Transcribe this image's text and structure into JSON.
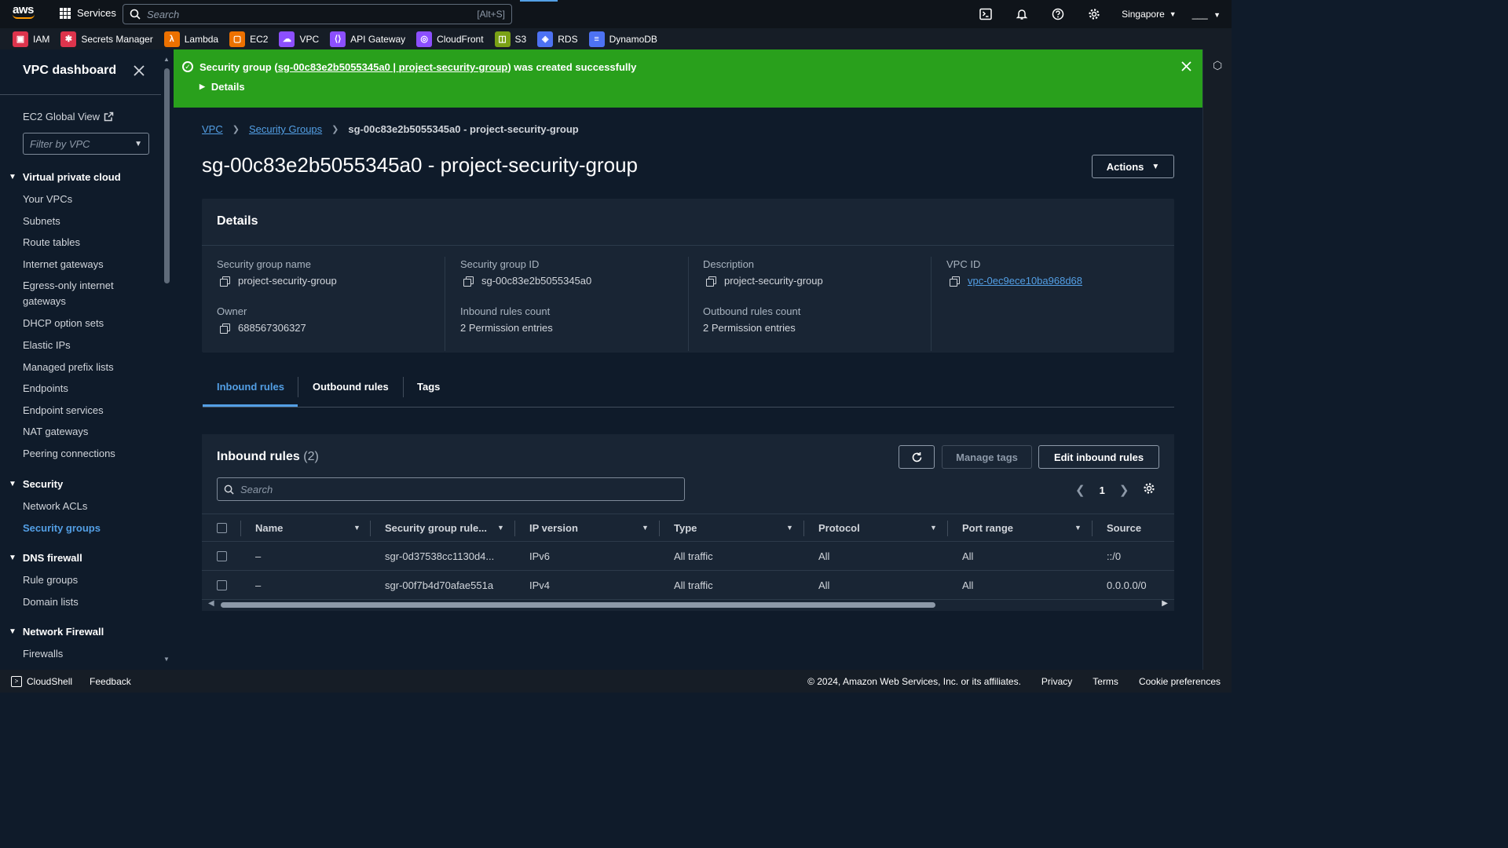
{
  "topnav": {
    "logo_text": "aws",
    "services_label": "Services",
    "search_placeholder": "Search",
    "search_shortcut": "[Alt+S]",
    "region": "Singapore",
    "account": "___"
  },
  "favorites": [
    {
      "label": "IAM",
      "color": "#dd344c"
    },
    {
      "label": "Secrets Manager",
      "color": "#dd344c"
    },
    {
      "label": "Lambda",
      "color": "#ed7100"
    },
    {
      "label": "EC2",
      "color": "#ed7100"
    },
    {
      "label": "VPC",
      "color": "#8c4fff"
    },
    {
      "label": "API Gateway",
      "color": "#8c4fff"
    },
    {
      "label": "CloudFront",
      "color": "#8c4fff"
    },
    {
      "label": "S3",
      "color": "#7aa116"
    },
    {
      "label": "RDS",
      "color": "#4d72f3"
    },
    {
      "label": "DynamoDB",
      "color": "#4d72f3"
    }
  ],
  "sidebar": {
    "title": "VPC dashboard",
    "global_view": "EC2 Global View",
    "filter_placeholder": "Filter by VPC",
    "sections": {
      "vpc": "Virtual private cloud",
      "security": "Security",
      "dns": "DNS firewall",
      "nfw": "Network Firewall"
    },
    "vpc_items": [
      "Your VPCs",
      "Subnets",
      "Route tables",
      "Internet gateways",
      "Egress-only internet",
      "gateways",
      "DHCP option sets",
      "Elastic IPs",
      "Managed prefix lists",
      "Endpoints",
      "Endpoint services",
      "NAT gateways",
      "Peering connections"
    ],
    "security_items": [
      "Network ACLs",
      "Security groups"
    ],
    "dns_items": [
      "Rule groups",
      "Domain lists"
    ],
    "nfw_items": [
      "Firewalls"
    ]
  },
  "flash": {
    "prefix": "Security group (",
    "link": "sg-00c83e2b5055345a0 | project-security-group",
    "suffix": ") was created successfully",
    "details": "Details"
  },
  "breadcrumb": {
    "vpc": "VPC",
    "sg": "Security Groups",
    "current": "sg-00c83e2b5055345a0 - project-security-group"
  },
  "page_title": "sg-00c83e2b5055345a0 - project-security-group",
  "actions_label": "Actions",
  "details": {
    "header": "Details",
    "sg_name_label": "Security group name",
    "sg_name": "project-security-group",
    "sg_id_label": "Security group ID",
    "sg_id": "sg-00c83e2b5055345a0",
    "desc_label": "Description",
    "desc": "project-security-group",
    "vpc_label": "VPC ID",
    "vpc_id": "vpc-0ec9ece10ba968d68",
    "owner_label": "Owner",
    "owner": "688567306327",
    "inbound_label": "Inbound rules count",
    "inbound": "2 Permission entries",
    "outbound_label": "Outbound rules count",
    "outbound": "2 Permission entries"
  },
  "tabs": [
    "Inbound rules",
    "Outbound rules",
    "Tags"
  ],
  "rules": {
    "title": "Inbound rules",
    "count": "(2)",
    "manage_tags": "Manage tags",
    "edit": "Edit inbound rules",
    "search_placeholder": "Search",
    "page": "1",
    "columns": [
      "Name",
      "Security group rule...",
      "IP version",
      "Type",
      "Protocol",
      "Port range",
      "Source"
    ],
    "rows": [
      [
        "–",
        "sgr-0d37538cc1130d4...",
        "IPv6",
        "All traffic",
        "All",
        "All",
        "::/0"
      ],
      [
        "–",
        "sgr-00f7b4d70afae551a",
        "IPv4",
        "All traffic",
        "All",
        "All",
        "0.0.0.0/0"
      ]
    ]
  },
  "footer": {
    "cloudshell": "CloudShell",
    "feedback": "Feedback",
    "copyright": "© 2024, Amazon Web Services, Inc. or its affiliates.",
    "privacy": "Privacy",
    "terms": "Terms",
    "cookies": "Cookie preferences"
  }
}
